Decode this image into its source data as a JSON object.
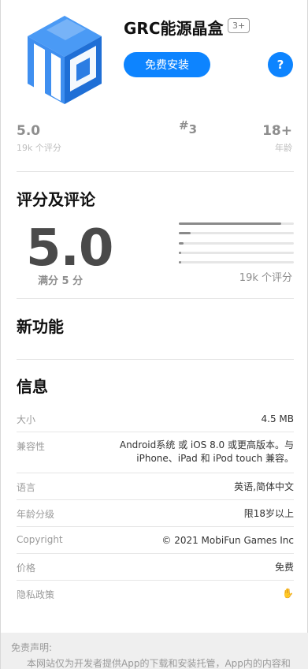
{
  "app": {
    "title": "GRC能源晶盒",
    "age_badge": "3+",
    "install_label": "免费安装",
    "help_label": "?",
    "icon": "app-logo-icon",
    "accent_color": "#0d84ff",
    "logo_colors": [
      "#3d8ff2",
      "#1f6fd6",
      "#ffffff"
    ]
  },
  "stats": {
    "rating_value": "5.0",
    "rating_count": "19k 个评分",
    "rank_symbol": "#",
    "rank_value": "3",
    "age_value": "18+",
    "age_label": "年龄"
  },
  "ratings": {
    "heading": "评分及评论",
    "score": "5.0",
    "caption": "满分 5 分",
    "count": "19k 个评分",
    "distribution": [
      0.89,
      0.1,
      0.04,
      0.02,
      0.02
    ]
  },
  "whats_new": {
    "heading": "新功能"
  },
  "info": {
    "heading": "信息",
    "rows": [
      {
        "label": "大小",
        "value": "4.5 MB"
      },
      {
        "label": "兼容性",
        "value": "Android系统 或 iOS 8.0 或更高版本。与 iPhone、iPad 和 iPod touch 兼容。"
      },
      {
        "label": "语言",
        "value": "英语,简体中文"
      },
      {
        "label": "年龄分级",
        "value": "限18岁以上"
      },
      {
        "label": "Copyright",
        "value": "© 2021 MobiFun Games Inc"
      },
      {
        "label": "价格",
        "value": "免费"
      },
      {
        "label": "隐私政策",
        "value": "✋"
      }
    ]
  },
  "disclaimer": {
    "title": "免责声明:",
    "text": "本网站仅为开发者提供App的下载和安装托管，App内的内容和"
  }
}
